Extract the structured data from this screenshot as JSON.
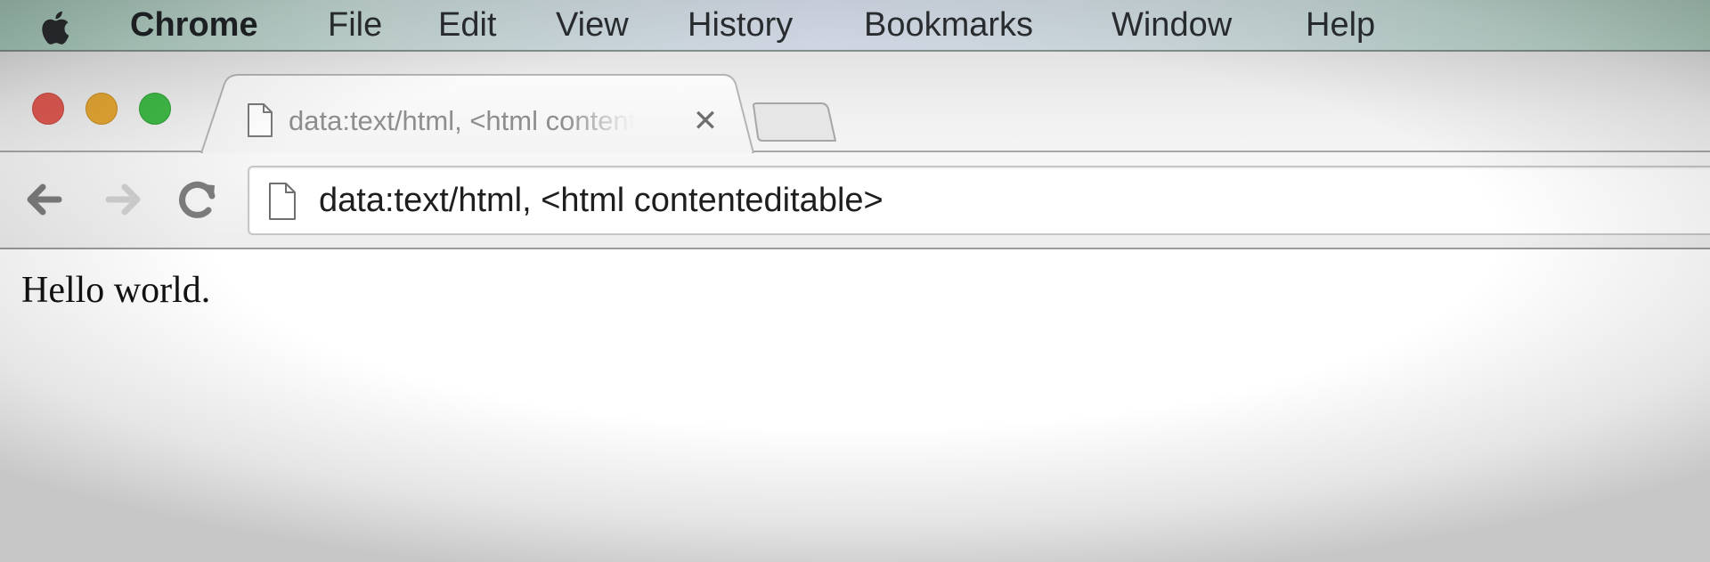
{
  "menubar": {
    "apple_icon": "apple-logo-icon",
    "app_name": "Chrome",
    "items": [
      "File",
      "Edit",
      "View",
      "History",
      "Bookmarks",
      "Window",
      "Help"
    ]
  },
  "window_controls": {
    "close_color": "#e25a52",
    "minimize_color": "#e5a733",
    "zoom_color": "#3fba46"
  },
  "tabs": [
    {
      "title": "data:text/html, <html contenteditable>",
      "icon": "document-icon",
      "close_glyph": "✕"
    }
  ],
  "toolbar": {
    "back_icon": "back-arrow-icon",
    "forward_icon": "forward-arrow-icon",
    "reload_icon": "reload-icon"
  },
  "omnibox": {
    "icon": "document-icon",
    "url": "data:text/html, <html contenteditable>"
  },
  "page": {
    "text": "Hello world."
  }
}
